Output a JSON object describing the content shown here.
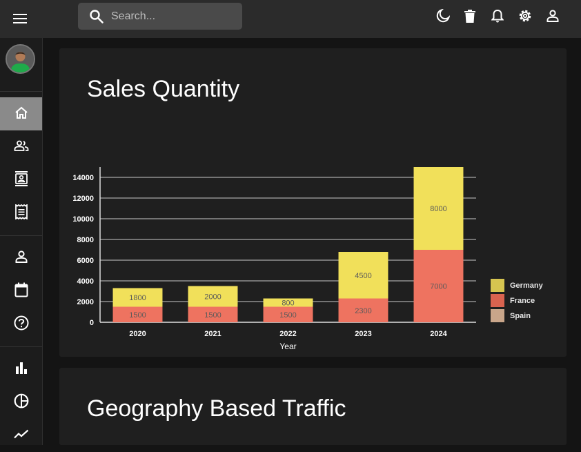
{
  "search": {
    "placeholder": "Search..."
  },
  "cards": {
    "sales_title": "Sales Quantity",
    "geo_title": "Geography Based Traffic"
  },
  "colors": {
    "germany": "#f1e05a",
    "france": "#ee7360",
    "spain": "#c9a68a",
    "legend_germany": "#d6c550",
    "legend_france": "#d9634f",
    "legend_spain": "#c9a68a"
  },
  "chart_data": {
    "type": "bar",
    "stacked": true,
    "categories": [
      "2020",
      "2021",
      "2022",
      "2023",
      "2024"
    ],
    "series": [
      {
        "name": "France",
        "values": [
          1500,
          1500,
          1500,
          2300,
          7000
        ]
      },
      {
        "name": "Germany",
        "values": [
          1800,
          2000,
          800,
          4500,
          8000
        ]
      },
      {
        "name": "Spain",
        "values": [
          0,
          0,
          0,
          0,
          0
        ]
      }
    ],
    "xlabel": "Year",
    "ylabel": "",
    "ylim": [
      0,
      15000
    ],
    "yticks": [
      0,
      2000,
      4000,
      6000,
      8000,
      10000,
      12000,
      14000
    ],
    "grid": true,
    "legend": "right"
  }
}
